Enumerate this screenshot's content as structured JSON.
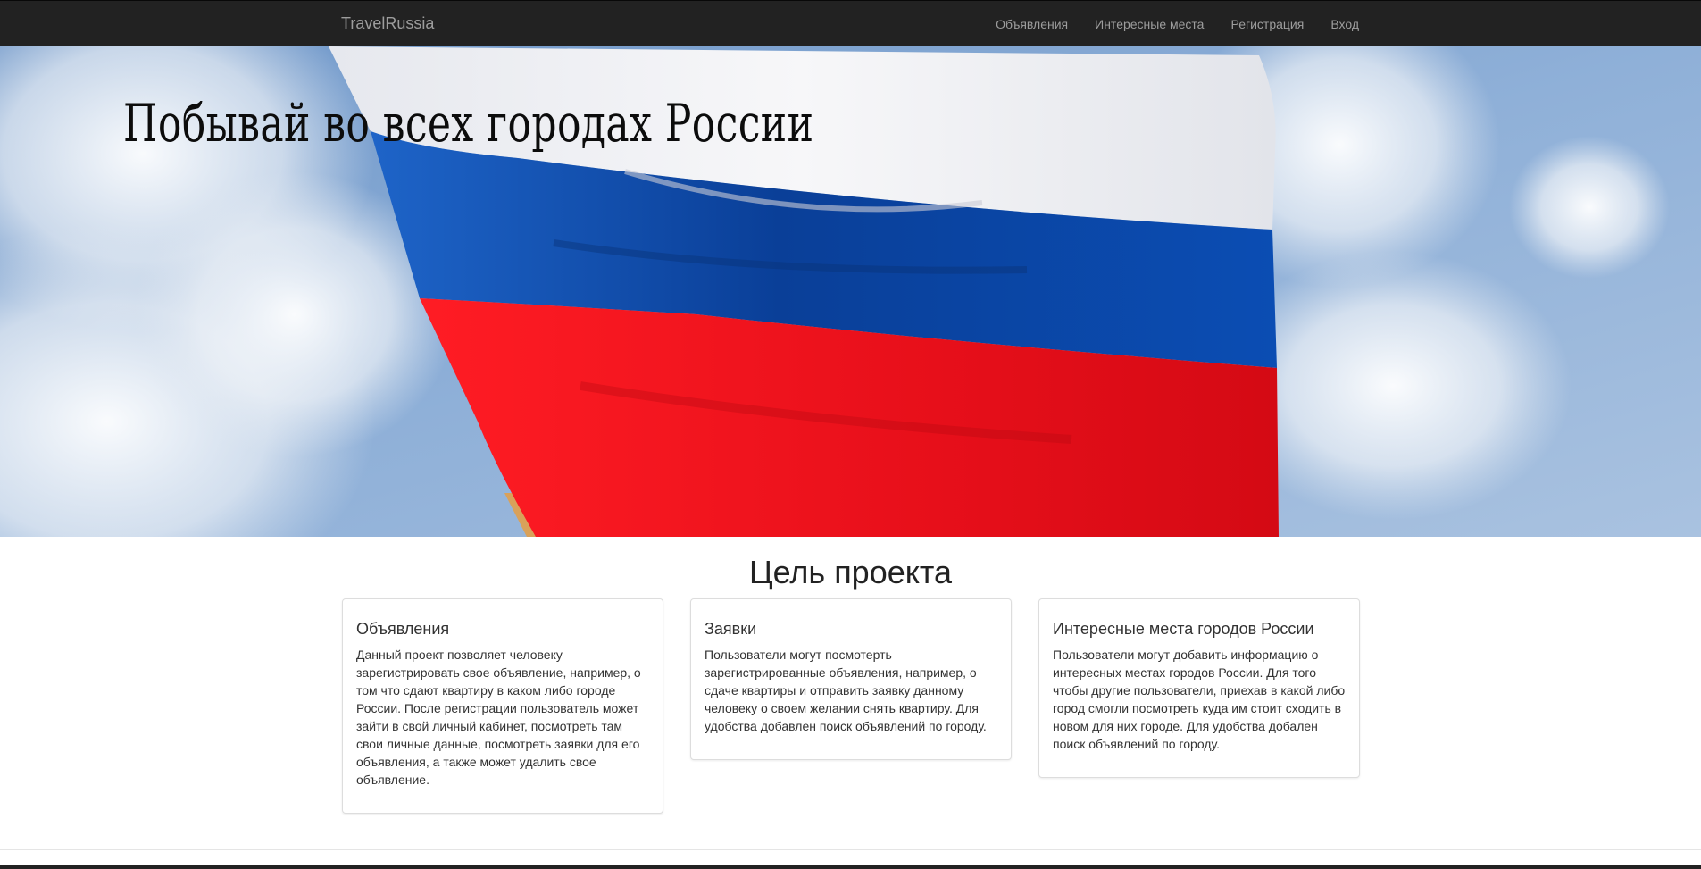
{
  "navbar": {
    "brand": "TravelRussia",
    "links": [
      {
        "label": "Объявления"
      },
      {
        "label": "Интересные места"
      },
      {
        "label": "Регистрация"
      },
      {
        "label": "Вход"
      }
    ]
  },
  "hero": {
    "title": "Побывай во всех городах России",
    "flag_colors": {
      "white": "#f4f4f6",
      "blue": "#0b4aa8",
      "red": "#f0141e"
    }
  },
  "section": {
    "title": "Цель проекта",
    "cards": [
      {
        "title": "Объявления",
        "text": "Данный проект позволяет человеку зарегистрировать свое объявление, например, о том что сдают квартиру в каком либо городе России. После регистрации пользователь может зайти в свой личный кабинет, посмотреть там свои личные данные, посмотреть заявки для его объявления, а также может удалить свое объявление."
      },
      {
        "title": "Заявки",
        "text": "Пользователи могут посмотерть зарегистрированные объявления, например, о сдаче квартиры и отправить заявку данному человеку о своем желании снять квартиру. Для удобства добавлен поиск объявлений по городу."
      },
      {
        "title": "Интересные места городов России",
        "text": "Пользователи могут добавить информацию о интересных местах городов России. Для того чтобы другие пользователи, приехав в какой либо город смогли посмотреть куда им стоит сходить в новом для них городе. Для удобства добален поиск объявлений по городу."
      }
    ]
  }
}
